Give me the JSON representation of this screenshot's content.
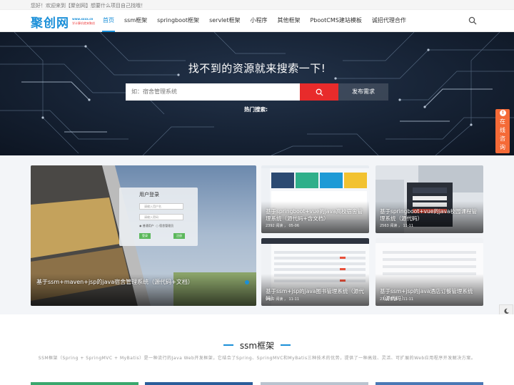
{
  "topbar": {
    "welcome": "您好！欢迎来到【聚创网】想要什么项目自己找哦！"
  },
  "logo": {
    "name": "聚创网",
    "url": "www.xxxx.cn",
    "slogan": "学计算机就来聚创"
  },
  "nav": {
    "items": [
      {
        "label": "首页",
        "active": true
      },
      {
        "label": "ssm框架"
      },
      {
        "label": "springboot框架"
      },
      {
        "label": "servlet框架"
      },
      {
        "label": "小程序"
      },
      {
        "label": "其他框架"
      },
      {
        "label": "PbootCMS建站模板"
      },
      {
        "label": "诚招代理合作"
      }
    ]
  },
  "hero": {
    "title": "找不到的资源就来搜索一下!",
    "search_placeholder": "如：宿舍管理系统",
    "publish_label": "发布需求",
    "hot_label": "热门搜索:"
  },
  "consult": {
    "label": "在线咨询",
    "badge": "!"
  },
  "cards": {
    "big": {
      "title": "基于ssm+maven+jsp的java宿舍管理系统（源代码+文档）",
      "login_title": "用户登录",
      "login_user": "请输入用户名",
      "login_pass": "请输入密码",
      "login_opt1": "普通用户",
      "login_opt2": "宿舍管理员",
      "login_btn1": "登录",
      "login_btn2": "注册"
    },
    "small": [
      {
        "title": "基于springboot+vue的java高校宿舍管理系统（源代码+含文档）",
        "meta": "2392 阅读 ， 05-06"
      },
      {
        "title": "基于springboot+vue的java校园课程管理系统（源代码）",
        "meta": "2563 阅读 ， 11-11"
      },
      {
        "title": "基于ssm+jsp的java图书管理系统（源代码）",
        "meta": "2632 阅读 ， 11-11"
      },
      {
        "title": "基于ssm+jsp的java酒店订餐管理系统（源代码）",
        "meta": "2392 阅读 ， 11-11"
      }
    ]
  },
  "section": {
    "title": "ssm框架",
    "desc": "SSM框架（Spring + SpringMVC + MyBatis）是一种流行的Java Web开发框架，它结合了Spring、SpringMVC和MyBatis三种技术的优势，提供了一种高效、灵活、可扩展的Web应用程序开发解决方案。"
  },
  "colors": {
    "accent": "#1a8fd8",
    "search_button": "#e82b2b",
    "consult": "#f56a37"
  }
}
